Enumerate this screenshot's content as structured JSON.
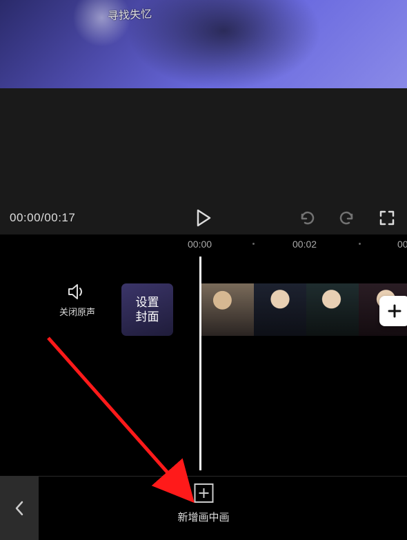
{
  "preview": {
    "watermark": "寻找失忆"
  },
  "status": {
    "current_time": "00:00",
    "total_time": "00:17",
    "separator": "/"
  },
  "ruler": {
    "ticks": [
      "00:00",
      "00:02",
      "00"
    ]
  },
  "track": {
    "mute_label": "关闭原声",
    "cover_label": "设置\n封面"
  },
  "bottom": {
    "pip_label": "新增画中画"
  },
  "icons": {
    "speaker": "speaker-icon",
    "play": "play-icon",
    "undo": "undo-icon",
    "redo": "redo-icon",
    "fullscreen": "fullscreen-icon",
    "plus_boxed": "plus-boxed-icon",
    "plus": "plus-icon",
    "chevron_left": "chevron-left-icon"
  }
}
